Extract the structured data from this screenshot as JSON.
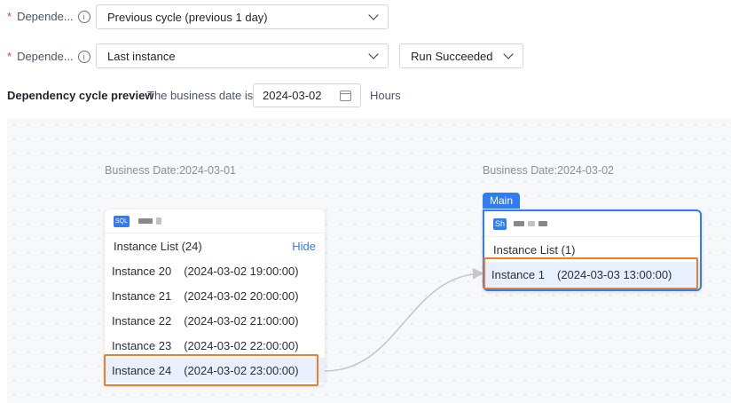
{
  "form": {
    "row1": {
      "required": "*",
      "label": "Depende...",
      "select_value": "Previous cycle (previous 1 day)"
    },
    "row2": {
      "required": "*",
      "label": "Depende...",
      "select_value": "Last instance",
      "status_value": "Run Succeeded"
    },
    "info_glyph": "i"
  },
  "preview": {
    "title": "Dependency cycle preview",
    "business_date_text": "The business date is",
    "date_value": "2024-03-02",
    "hours_label": "Hours"
  },
  "left_card": {
    "business_date": "Business Date:2024-03-01",
    "type_tag": "SQL",
    "list_title": "Instance List (24)",
    "hide_label": "Hide",
    "instances": [
      {
        "name": "Instance 20",
        "time": "(2024-03-02 19:00:00)"
      },
      {
        "name": "Instance 21",
        "time": "(2024-03-02 20:00:00)"
      },
      {
        "name": "Instance 22",
        "time": "(2024-03-02 21:00:00)"
      },
      {
        "name": "Instance 23",
        "time": "(2024-03-02 22:00:00)"
      },
      {
        "name": "Instance 24",
        "time": "(2024-03-02 23:00:00)"
      }
    ]
  },
  "right_card": {
    "badge": "Main",
    "business_date": "Business Date:2024-03-02",
    "type_tag": "Sh",
    "list_title": "Instance List (1)",
    "instances": [
      {
        "name": "Instance 1",
        "time": "(2024-03-03 13:00:00)"
      }
    ]
  },
  "colors": {
    "accent": "#2f7cf6",
    "highlight": "#ee7d2a",
    "required": "#e54545"
  }
}
